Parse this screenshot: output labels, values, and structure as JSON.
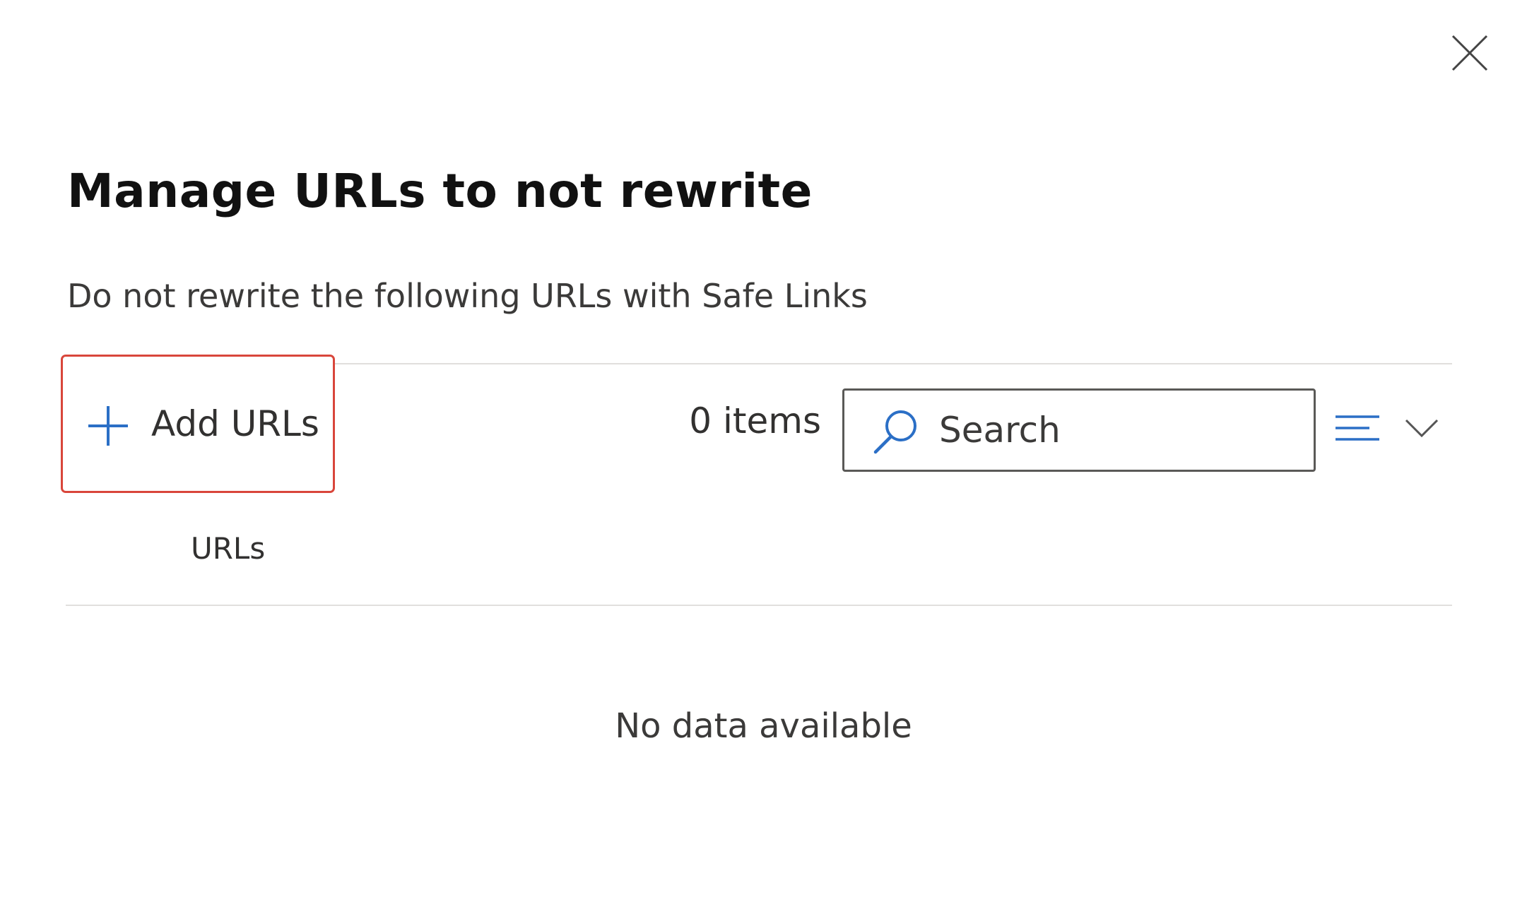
{
  "panel": {
    "title": "Manage URLs to not rewrite",
    "description": "Do not rewrite the following URLs with Safe Links",
    "close_icon": "close-icon"
  },
  "toolbar": {
    "add_label": "Add URLs",
    "add_icon": "plus-icon",
    "item_count": "0 items",
    "search_placeholder": "Search",
    "search_icon": "search-icon",
    "filter_icon": "filter-lines-icon",
    "filter_chevron_icon": "chevron-down-icon"
  },
  "table": {
    "columns": [
      "URLs"
    ],
    "rows": [],
    "empty_message": "No data available"
  },
  "colors": {
    "accent": "#2b6fc6",
    "highlight_border": "#d9463b",
    "divider": "#e1dfdd"
  }
}
